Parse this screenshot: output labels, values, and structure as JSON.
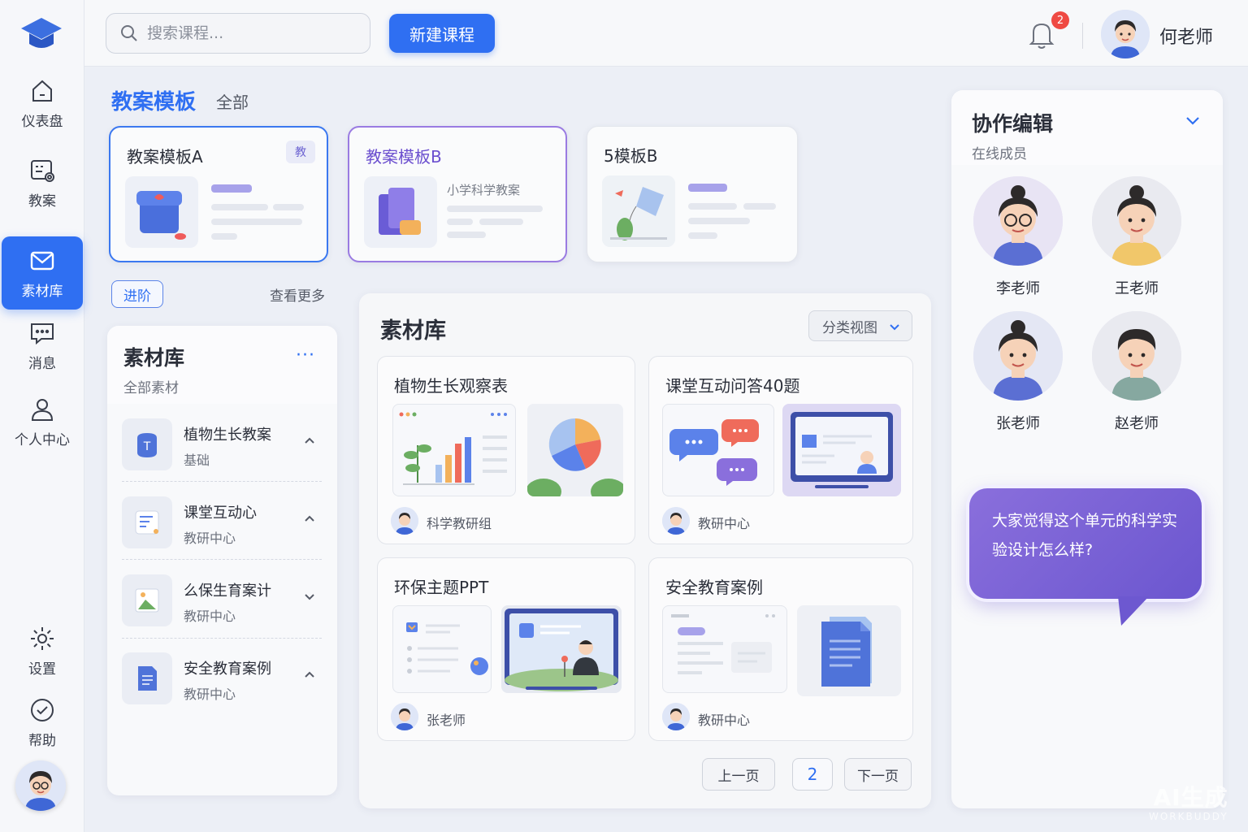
{
  "sidebar": {
    "items": [
      {
        "label": "仪表盘",
        "icon": "home-icon"
      },
      {
        "label": "教案",
        "icon": "lesson-plan-icon"
      },
      {
        "label": "素材库",
        "icon": "mail-icon"
      },
      {
        "label": "消息",
        "icon": "message-icon"
      },
      {
        "label": "个人中心",
        "icon": "user-icon"
      }
    ],
    "bottom": [
      {
        "label": "设置",
        "icon": "gear-icon"
      },
      {
        "label": "帮助",
        "icon": "help-icon"
      }
    ]
  },
  "header": {
    "search_placeholder": "搜索课程...",
    "new_course_label": "新建课程",
    "notification_count": "2",
    "user_name": "何老师"
  },
  "templates": {
    "title": "教案模板",
    "filter": "全部",
    "cards": [
      {
        "name": "教案模板A",
        "tag": "教"
      },
      {
        "name": "教案模板B",
        "subtitle": "小学科学教案"
      },
      {
        "name": "5模板B"
      }
    ],
    "advance_label": "进阶",
    "more_label": "查看更多"
  },
  "material_list": {
    "title": "素材库",
    "subtitle": "全部素材",
    "more": "···",
    "items": [
      {
        "name": "植物生长教案",
        "sub": "基础",
        "chevron": "up"
      },
      {
        "name": "课堂互动心",
        "sub": "教研中心",
        "chevron": "up"
      },
      {
        "name": "么保生育案计",
        "sub": "教研中心",
        "chevron": "down"
      },
      {
        "name": "安全教育案例",
        "sub": "教研中心",
        "chevron": "up"
      }
    ]
  },
  "library": {
    "title": "素材库",
    "view_label": "分类视图",
    "cards": [
      {
        "title": "植物生长观察表",
        "author": "科学教研组"
      },
      {
        "title": "课堂互动问答40题",
        "author": "教研中心"
      },
      {
        "title": "环保主题PPT",
        "author": "张老师"
      },
      {
        "title": "安全教育案例",
        "author": "教研中心"
      }
    ],
    "pager": {
      "prev": "上一页",
      "current": "2",
      "next": "下一页"
    }
  },
  "collab": {
    "title": "协作编辑",
    "subtitle": "在线成员",
    "members": [
      "李老师",
      "王老师",
      "张老师",
      "赵老师"
    ],
    "message": "大家觉得这个单元的科学实验设计怎么样?"
  },
  "watermark": {
    "line1": "AI生成",
    "line2": "WORKBUDDY"
  },
  "colors": {
    "primary": "#2f6ff2",
    "accent_purple": "#7b62d6",
    "badge": "#ef4a43"
  }
}
